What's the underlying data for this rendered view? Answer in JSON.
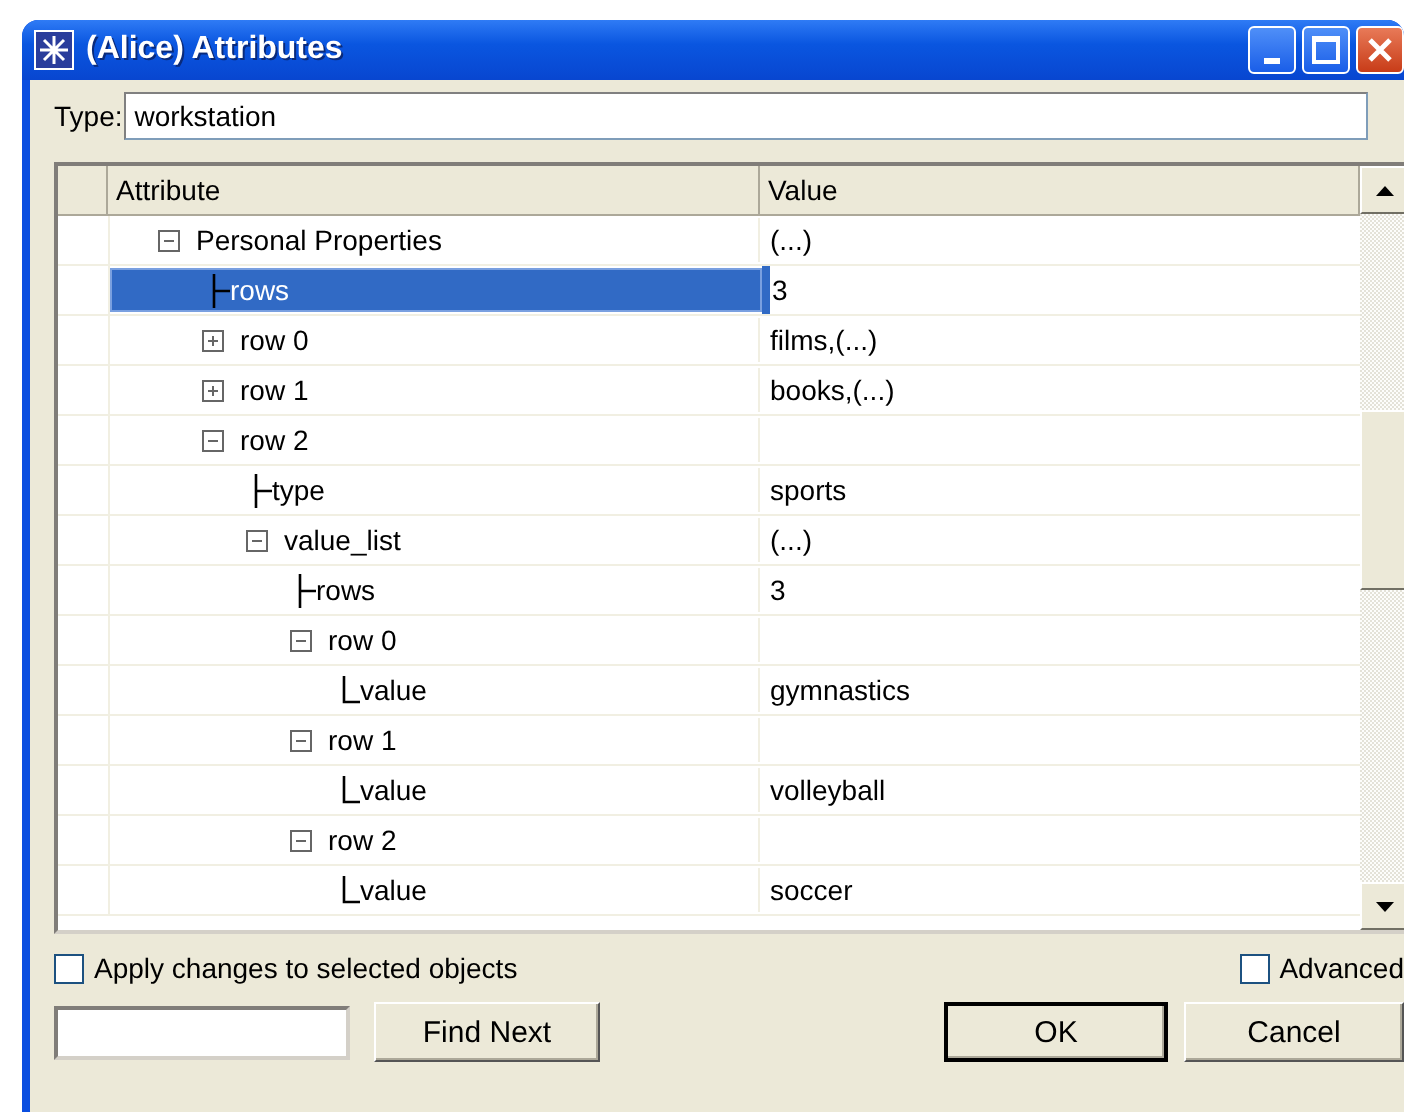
{
  "window": {
    "title": "(Alice) Attributes"
  },
  "type_field": {
    "label": "Type:",
    "value": "workstation"
  },
  "table": {
    "columns": [
      "Attribute",
      "Value"
    ],
    "rows": [
      {
        "attribute": "Personal Properties",
        "value": "(...)",
        "expanded": true,
        "selected": false,
        "children": [
          {
            "attribute": "rows",
            "value": "3",
            "selected": true
          },
          {
            "attribute": "row 0",
            "value": "films,(...)",
            "expanded": false,
            "selected": false
          },
          {
            "attribute": "row 1",
            "value": "books,(...)",
            "expanded": false,
            "selected": false
          },
          {
            "attribute": "row 2",
            "expanded": true,
            "selected": false,
            "children": [
              {
                "attribute": "type",
                "value": "sports",
                "selected": false
              },
              {
                "attribute": "value_list",
                "value": "(...)",
                "expanded": true,
                "selected": false,
                "children": [
                  {
                    "attribute": "rows",
                    "value": "3",
                    "selected": false
                  },
                  {
                    "attribute": "row 0",
                    "expanded": true,
                    "selected": false,
                    "children": [
                      {
                        "attribute": "value",
                        "value": "gymnastics",
                        "selected": false
                      }
                    ]
                  },
                  {
                    "attribute": "row 1",
                    "expanded": true,
                    "selected": false,
                    "children": [
                      {
                        "attribute": "value",
                        "value": "volleyball",
                        "selected": false
                      }
                    ]
                  },
                  {
                    "attribute": "row 2",
                    "expanded": true,
                    "selected": false,
                    "children": [
                      {
                        "attribute": "value",
                        "value": "soccer",
                        "selected": false
                      }
                    ]
                  }
                ]
              }
            ]
          }
        ]
      }
    ]
  },
  "apply_changes": {
    "label": "Apply changes to selected objects",
    "checked": false
  },
  "advanced": {
    "label": "Advanced",
    "checked": false
  },
  "buttons": {
    "find_next": "Find Next",
    "ok": "OK",
    "cancel": "Cancel"
  }
}
